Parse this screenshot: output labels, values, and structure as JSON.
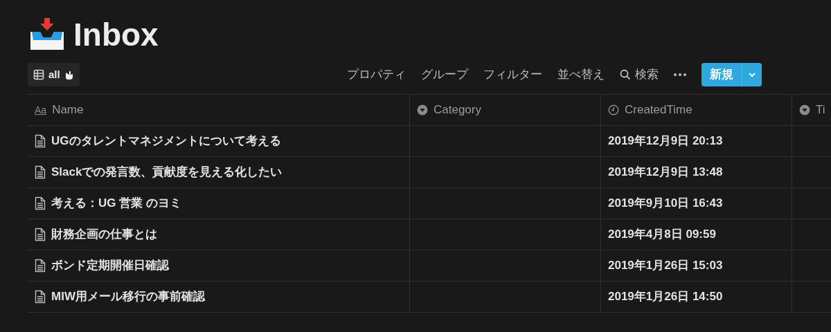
{
  "page": {
    "title": "Inbox"
  },
  "view": {
    "label": "all"
  },
  "toolbar": {
    "actions": [
      "プロパティ",
      "グループ",
      "フィルター",
      "並べ替え"
    ],
    "search": "検索",
    "new_button": "新規"
  },
  "table": {
    "columns": [
      {
        "kind": "title",
        "glyph": "Aa",
        "label": "Name"
      },
      {
        "kind": "select",
        "label": "Category"
      },
      {
        "kind": "created_time",
        "label": "CreatedTime"
      },
      {
        "kind": "select",
        "label": "Ti"
      }
    ],
    "rows": [
      {
        "name": "UGのタレントマネジメントについて考える",
        "created": "2019年12月9日 20:13"
      },
      {
        "name": "Slackでの発言数、貢献度を見える化したい",
        "created": "2019年12月9日 13:48"
      },
      {
        "name": "考える：UG 営業 のヨミ",
        "created": "2019年9月10日 16:43"
      },
      {
        "name": "財務企画の仕事とは",
        "created": "2019年4月8日 09:59"
      },
      {
        "name": "ボンド定期開催日確認",
        "created": "2019年1月26日 15:03"
      },
      {
        "name": "MIW用メール移行の事前確認",
        "created": "2019年1月26日 14:50"
      }
    ]
  }
}
